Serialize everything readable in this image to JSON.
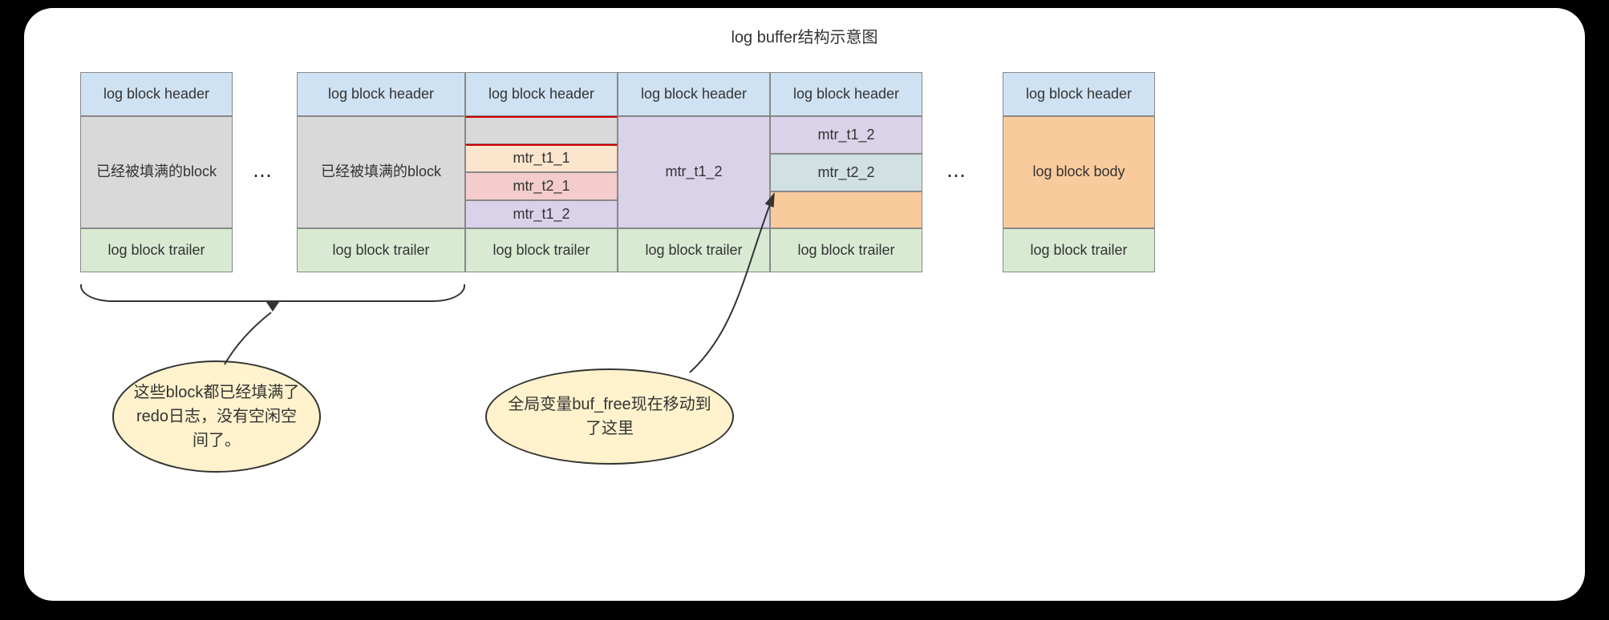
{
  "title": "log buffer结构示意图",
  "labels": {
    "header": "log block header",
    "trailer": "log block trailer",
    "body": "log block body",
    "filled": "已经被填满的block",
    "mtr_t1_1": "mtr_t1_1",
    "mtr_t2_1": "mtr_t2_1",
    "mtr_t1_2": "mtr_t1_2",
    "mtr_t2_2": "mtr_t2_2",
    "ellipsis": "⋯"
  },
  "callouts": {
    "left": "这些block都已经填满了redo日志，没有空闲空间了。",
    "right": "全局变量buf_free现在移动到了这里"
  }
}
